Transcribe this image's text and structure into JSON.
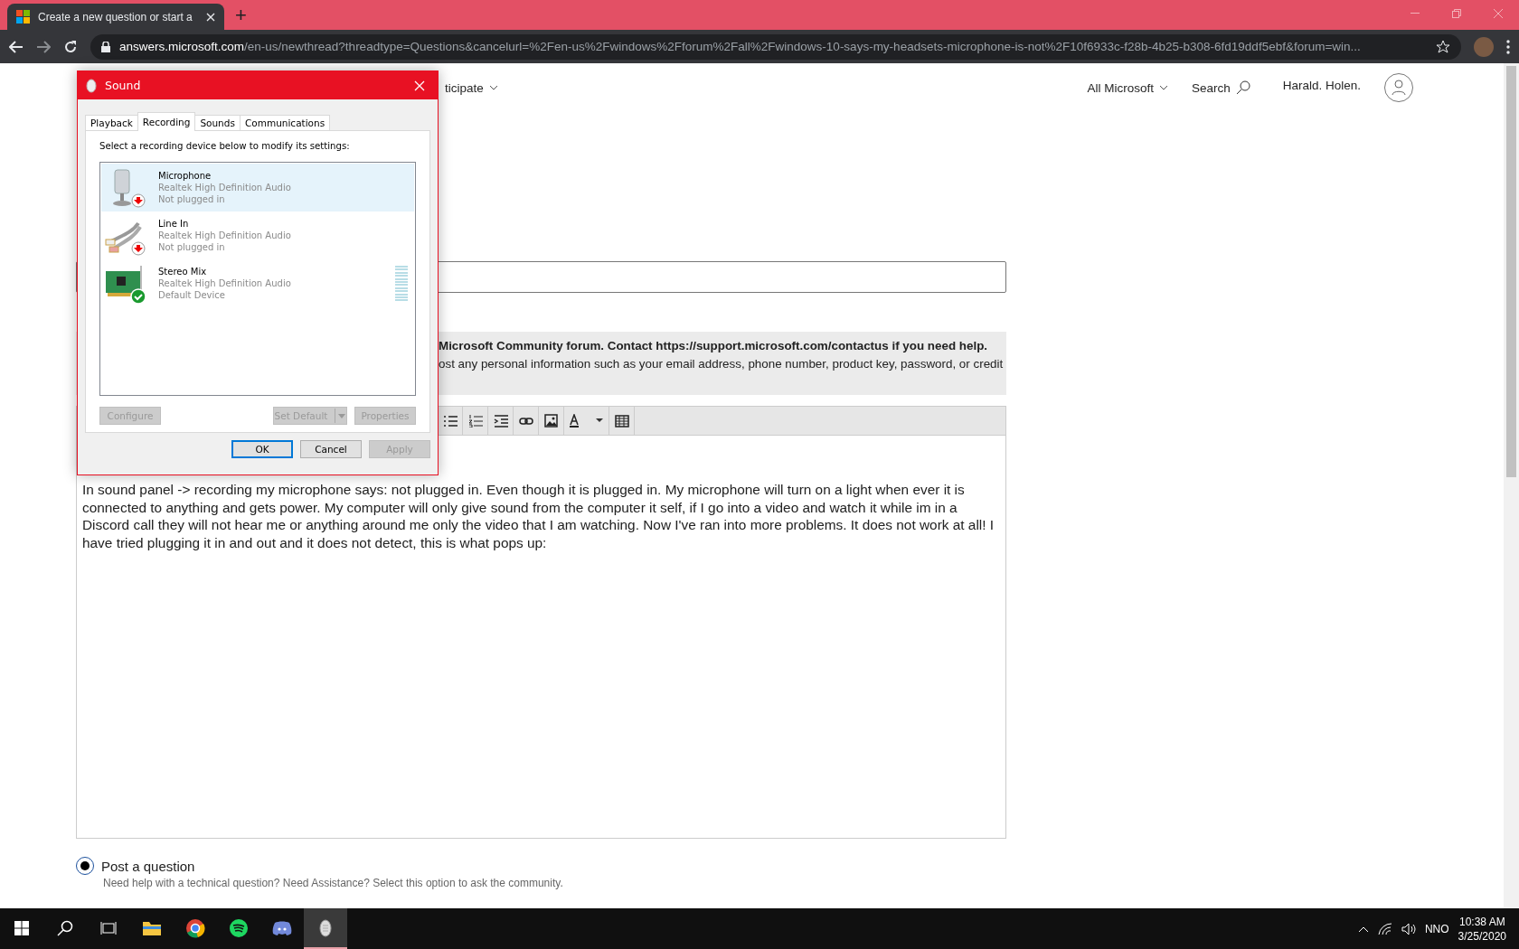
{
  "browser": {
    "tab_title": "Create a new question or start a",
    "new_tab": "+",
    "url": "**answers.microsoft.com**/en-us/newthread?threadtype=Questions&cancelurl=%2Fen-us%2Fwindows%2Fforum%2Fall%2Fwindows-10-says-my-headsets-microphone-is-not%2F10f6933c-f28b-4b25-b308-6fd19ddf5ebf&forum=win..."
  },
  "site_nav": {
    "left_item": "ticipate",
    "all_microsoft": "All Microsoft",
    "search": "Search",
    "user": "Harald. Holen."
  },
  "notice": {
    "line_1": "Microsoft Community forum. Contact https://support.microsoft.com/contactus if you need help.",
    "line_2": "ost any personal information such as your email address, phone number, product key, password, or credit"
  },
  "editor_toolbar": [
    {
      "kind": "bullets"
    },
    {
      "kind": "numbers"
    },
    {
      "kind": "indent"
    },
    {
      "kind": "link"
    },
    {
      "kind": "image"
    },
    {
      "kind": "font-color"
    },
    {
      "kind": "table"
    }
  ],
  "body_text": "In sound panel -> recording my microphone says: not plugged in. Even though it is plugged in. My microphone will turn on a light when ever it is connected to anything and gets power. My computer will only give sound from the computer it self, if I go into a video and watch it while im in a Discord call they will not hear me or anything around me only the video that I am watching. Now I've ran into more problems. It does not work at all! I have tried plugging it in and out and it does not detect, this is what pops up:",
  "post_option": {
    "label": "Post a question",
    "description": "Need help with a technical question? Need Assistance? Select this option to ask the community.",
    "selected": true
  },
  "dialog": {
    "title": "Sound",
    "tabs": [
      {
        "label": "Playback",
        "selected": false
      },
      {
        "label": "Recording",
        "selected": true
      },
      {
        "label": "Sounds",
        "selected": false
      },
      {
        "label": "Communications",
        "selected": false
      }
    ],
    "instruction": "Select a recording device below to modify its settings:",
    "devices": [
      {
        "kind": "microphone",
        "name": "Microphone",
        "driver": "Realtek High Definition Audio",
        "status": "Not plugged in",
        "plugged_in": false,
        "default": false,
        "selected": true
      },
      {
        "kind": "line-in",
        "name": "Line In",
        "driver": "Realtek High Definition Audio",
        "status": "Not plugged in",
        "plugged_in": false,
        "default": false,
        "selected": false
      },
      {
        "kind": "sound-card",
        "name": "Stereo Mix",
        "driver": "Realtek High Definition Audio",
        "status": "Default Device",
        "default": true,
        "selected": false,
        "level": 0
      }
    ],
    "device_buttons": [
      {
        "label": "Configure",
        "disabled": true
      },
      {
        "label": "Set Default",
        "disabled": true,
        "split": true
      },
      {
        "label": "Properties",
        "disabled": true
      }
    ],
    "footer_buttons": [
      {
        "label": "OK",
        "disabled": false,
        "default": true
      },
      {
        "label": "Cancel",
        "disabled": false,
        "default": false
      },
      {
        "label": "Apply",
        "disabled": true,
        "default": false
      }
    ]
  },
  "taskbar": {
    "apps": [
      {
        "kind": "explorer",
        "active": false
      },
      {
        "kind": "chrome",
        "active": false
      },
      {
        "kind": "spotify",
        "active": false
      },
      {
        "kind": "discord",
        "active": false
      },
      {
        "kind": "sound",
        "active": true
      }
    ],
    "language": "NNO",
    "time": "10:38 AM",
    "date": "3/25/2020"
  }
}
